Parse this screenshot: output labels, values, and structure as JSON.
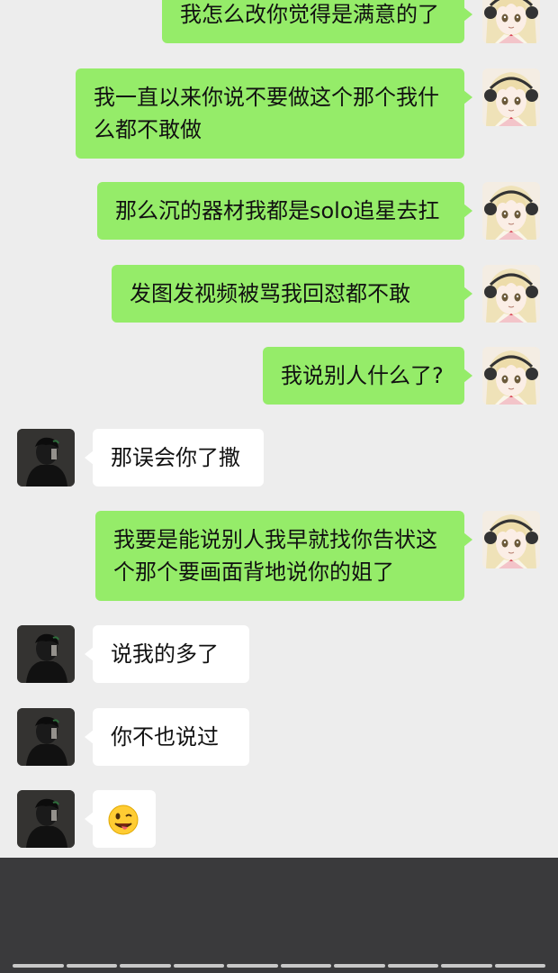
{
  "messages": [
    {
      "side": "out",
      "text": "我怎么改你觉得是满意的了"
    },
    {
      "side": "out",
      "line1": "我一直以来你说不要做这个那个我什",
      "line2": "么都不敢做"
    },
    {
      "side": "out",
      "text": "那么沉的器材我都是solo追星去扛"
    },
    {
      "side": "out",
      "text": "发图发视频被骂我回怼都不敢"
    },
    {
      "side": "out",
      "text": "我说别人什么了?"
    },
    {
      "side": "in",
      "text": "那误会你了撒"
    },
    {
      "side": "out",
      "line1": "我要是能说别人我早就找你告状这",
      "line2": "个那个要画面背地说你的姐了"
    },
    {
      "side": "in",
      "text": "说我的多了"
    },
    {
      "side": "in",
      "text": "你不也说过"
    },
    {
      "side": "in",
      "emoji": "winking-tongue-face"
    }
  ],
  "colors": {
    "outgoing_bubble": "#95ec69",
    "incoming_bubble": "#ffffff",
    "chat_background": "#ededed",
    "bottom_panel": "#3a3a3c"
  },
  "icons": {
    "my_avatar": "anime-girl-avatar",
    "their_avatar": "dark-figure-avatar"
  },
  "progress_segments": 10
}
